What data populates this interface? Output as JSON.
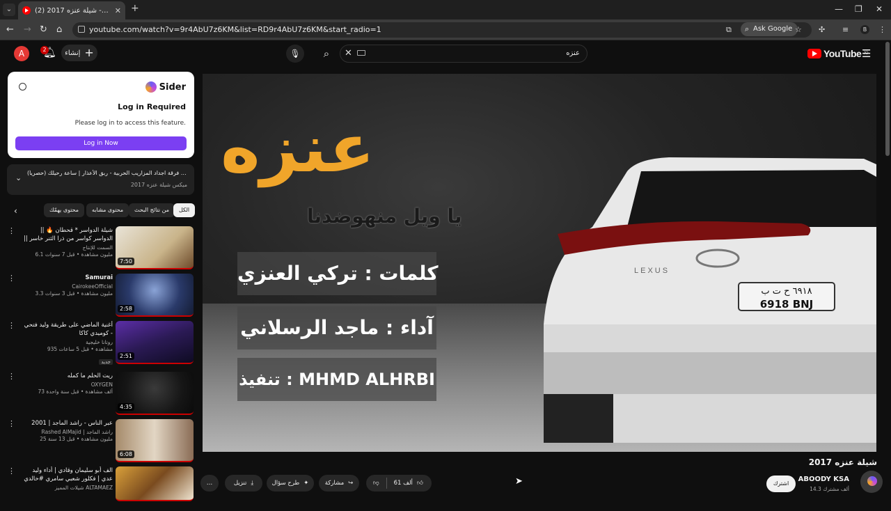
{
  "browser": {
    "tab_title": "(2) شيلة عنزه 2017 - YouTube",
    "tab_list_glyph": "⌄",
    "new_tab_glyph": "+",
    "close_glyph": "✕",
    "url": "youtube.com/watch?v=9r4AbU7z6KM&list=RD9r4AbU7z6KM&start_radio=1",
    "ask_google": "Ask Google",
    "profile_initial": "B",
    "window": {
      "minimize": "—",
      "maximize": "❐",
      "close": "✕"
    }
  },
  "youtube": {
    "avatar_initial": "A",
    "notification_count": "2",
    "create_label": "إنشاء",
    "search_query": "عنزه",
    "logo_text": "YouTube",
    "logo_region": "JO"
  },
  "sider": {
    "brand": "Sider",
    "title": "Log in Required",
    "message": "Please log in to access this feature.",
    "login_button": "Log in Now"
  },
  "playlist": {
    "now_playing": "التالي: فرقة اجداد المزاريب الحربية - ربق الأعذار | ساعة رحيلك (حصرياً)...",
    "name": "ميكس شيلة عنزه 2017"
  },
  "chips": [
    "الكل",
    "من نتائج البحث",
    "محتوى مشابه",
    "محتوى يهمّك"
  ],
  "recommendations": [
    {
      "title": "شيلة الدواسر * قحطان 🔥 || الدواسر كواسر من ذرا الثنر خاسر || جديد : فهد بن فصلا ...",
      "channel": "السمت للإنتاج",
      "meta": "6.1 مليون مشاهدة • قبل 7 سنوات",
      "duration": "7:50",
      "badge": ""
    },
    {
      "title": "Samurai",
      "channel": "CairokeeOfficial",
      "meta": "3.3 مليون مشاهدة • قبل 3 سنوات",
      "duration": "2:58",
      "badge": ""
    },
    {
      "title": "أغنية الماضي على طريقة وليد فتحي - كوميدي كاكا",
      "channel": "روتانا خليجية",
      "meta": "935 مشاهدة • قبل 5 ساعات",
      "duration": "2:51",
      "badge": "جديد"
    },
    {
      "title": "ريت الحلم ما كمله",
      "channel": "OXYGEN",
      "meta": "73 ألف مشاهدة • قبل سنة واحدة",
      "duration": "4:35",
      "badge": ""
    },
    {
      "title": "عبر الناس - راشد الماجد | 2001",
      "channel": "Rashed AlMajid | راشد الماجد",
      "meta": "25 مليون مشاهدة • قبل 13 سنة",
      "duration": "6:08",
      "badge": ""
    },
    {
      "title": "الف أبو سليمان وقادي | أداء وليد عدي | فكلور شعبي سامري #خالدي",
      "channel": "شيلات المميز ALTAMAEZ",
      "meta": "12 مليون مشاهدة • قبل 4 سنوات",
      "duration": "",
      "badge": ""
    }
  ],
  "video": {
    "title": "شيلة عنزه 2017",
    "overlay_title": "عنزه",
    "overlay_subtitle": "يا ويل منهوضدنا",
    "credits": [
      "كلمات : تركي العنزي",
      "آداء : ماجد الرسلاني",
      "تنفيذ : MHMD ALHRBI"
    ],
    "plate_arabic": "٦٩١٨ ح ت ب",
    "plate_latin": "6918 BNJ",
    "car_brand": "LEXUS"
  },
  "actions": {
    "likes": "61 ألف",
    "share": "مشاركة",
    "ask": "طرح سؤال",
    "download": "تنزيل",
    "more": "…"
  },
  "channel": {
    "name": "ABOODY KSA",
    "subscribers": "14.3 ألف مشترك",
    "subscribe": "اشترك"
  }
}
